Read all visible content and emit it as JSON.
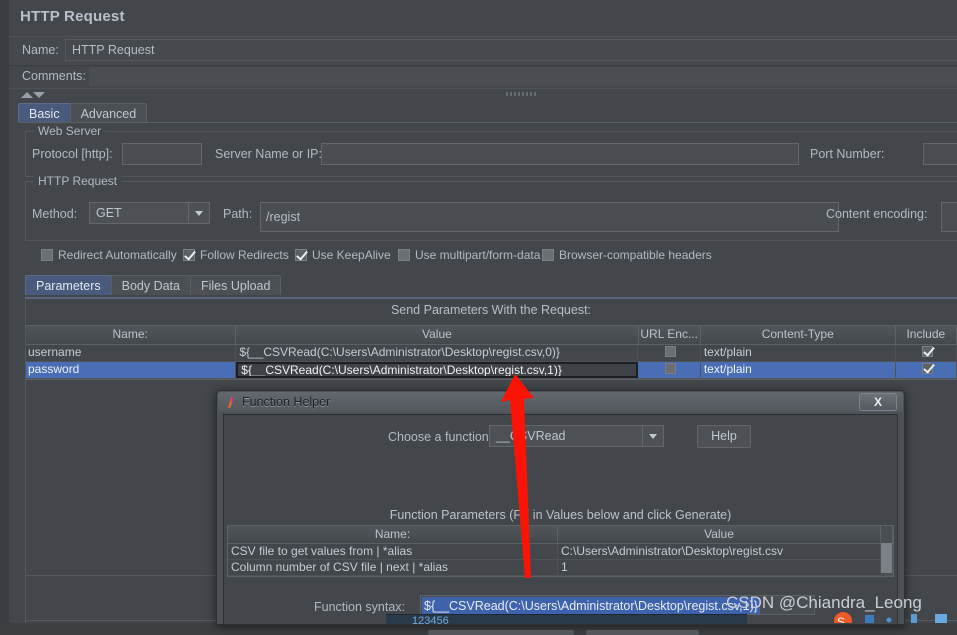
{
  "window": {
    "title": "HTTP Request"
  },
  "name_row": {
    "label": "Name:",
    "value": "HTTP Request"
  },
  "comments_row": {
    "label": "Comments:",
    "value": ""
  },
  "main_tabs": [
    {
      "label": "Basic",
      "active": true
    },
    {
      "label": "Advanced",
      "active": false
    }
  ],
  "web_server": {
    "group_title": "Web Server",
    "protocol_label": "Protocol [http]:",
    "protocol_value": "",
    "server_label": "Server Name or IP:",
    "server_value": "",
    "port_label": "Port Number:",
    "port_value": ""
  },
  "http_request": {
    "group_title": "HTTP Request",
    "method_label": "Method:",
    "method_value": "GET",
    "path_label": "Path:",
    "path_value": "/regist",
    "content_encoding_label": "Content encoding:",
    "content_encoding_value": ""
  },
  "checkboxes": [
    {
      "label": "Redirect Automatically",
      "checked": false
    },
    {
      "label": "Follow Redirects",
      "checked": true
    },
    {
      "label": "Use KeepAlive",
      "checked": true
    },
    {
      "label": "Use multipart/form-data",
      "checked": false
    },
    {
      "label": "Browser-compatible headers",
      "checked": false
    }
  ],
  "sub_tabs": [
    {
      "label": "Parameters",
      "active": true
    },
    {
      "label": "Body Data",
      "active": false
    },
    {
      "label": "Files Upload",
      "active": false
    }
  ],
  "parameters_table": {
    "caption": "Send Parameters With the Request:",
    "headers": [
      "Name:",
      "Value",
      "URL Enc...",
      "Content-Type",
      "Include"
    ],
    "rows": [
      {
        "name": "username",
        "value": "${__CSVRead(C:\\Users\\Administrator\\Desktop\\regist.csv,0)}",
        "url_encode": false,
        "content_type": "text/plain",
        "include": true,
        "selected": false,
        "editing": false
      },
      {
        "name": "password",
        "value": "${__CSVRead(C:\\Users\\Administrator\\Desktop\\regist.csv,1)}",
        "url_encode": false,
        "content_type": "text/plain",
        "include": true,
        "selected": true,
        "editing": true
      }
    ]
  },
  "function_helper": {
    "title": "Function Helper",
    "close_label": "X",
    "choose_label": "Choose a function",
    "function_value": "__CSVRead",
    "help_label": "Help",
    "params_title": "Function Parameters (Fill in Values below and click Generate)",
    "param_headers": [
      "Name:",
      "Value"
    ],
    "param_rows": [
      {
        "name": "CSV file to get values from | *alias",
        "value": "C:\\Users\\Administrator\\Desktop\\regist.csv"
      },
      {
        "name": "Column number of CSV file | next | *alias",
        "value": "1"
      }
    ],
    "syntax_label": "Function syntax:",
    "syntax_value": "${__CSVRead(C:\\Users\\Administrator\\Desktop\\regist.csv,1)}"
  },
  "annotation": {
    "arrow_color": "#fb1405"
  },
  "watermark": {
    "text": "CSDN @Chiandra_Leong"
  },
  "bottom_window": {
    "partial_text": "123456"
  }
}
